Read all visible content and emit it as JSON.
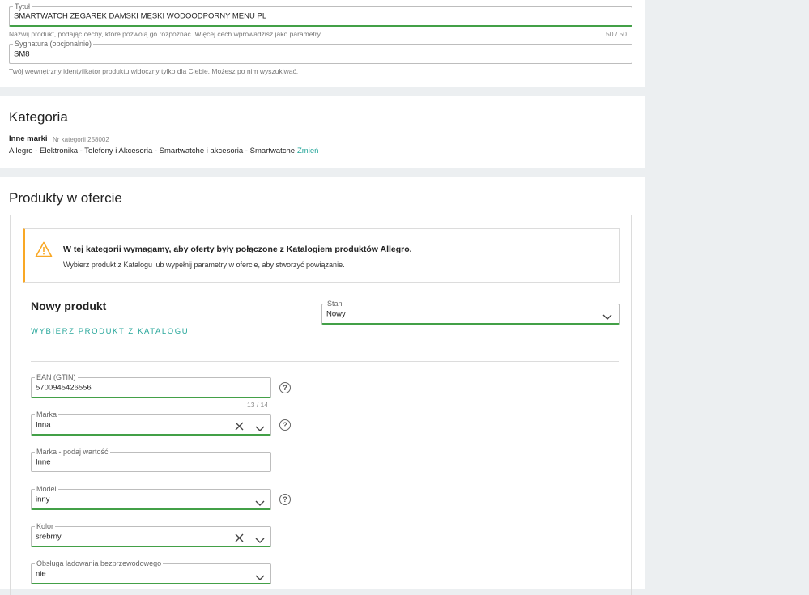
{
  "title_section": {
    "title_field": {
      "legend": "Tytuł",
      "value": "SMARTWATCH ZEGAREK DAMSKI MĘSKI WODOODPORNY MENU PL"
    },
    "title_hint": "Nazwij produkt, podając cechy, które pozwolą go rozpoznać. Więcej cech wprowadzisz jako parametry.",
    "title_counter": "50 / 50",
    "signature_field": {
      "legend": "Sygnatura (opcjonalnie)",
      "value": "SM8"
    },
    "signature_hint": "Twój wewnętrzny identyfikator produktu widoczny tylko dla Ciebie. Możesz po nim wyszukiwać."
  },
  "category": {
    "heading": "Kategoria",
    "name": "Inne marki",
    "number": "Nr kategorii 258002",
    "path": "Allegro - Elektronika - Telefony i Akcesoria - Smartwatche i akcesoria - Smartwatche",
    "change_label": "Zmień"
  },
  "products": {
    "heading": "Produkty w ofercie",
    "alert_title": "W tej kategorii wymagamy, aby oferty były połączone z Katalogiem produktów Allegro.",
    "alert_text": "Wybierz produkt z Katalogu lub wypełnij parametry w ofercie, aby stworzyć powiązanie.",
    "new_product_label": "Nowy produkt",
    "catalog_link": "WYBIERZ PRODUKT Z KATALOGU",
    "state": {
      "legend": "Stan",
      "value": "Nowy"
    },
    "ean": {
      "legend": "EAN (GTIN)",
      "value": "5700945426556",
      "counter": "13 / 14"
    },
    "brand": {
      "legend": "Marka",
      "value": "Inna"
    },
    "brand_value": {
      "legend": "Marka - podaj wartość",
      "value": "Inne"
    },
    "model": {
      "legend": "Model",
      "value": "inny"
    },
    "color": {
      "legend": "Kolor",
      "value": "srebrny"
    },
    "wireless": {
      "legend": "Obsługa ładowania bezprzewodowego",
      "value": "nie"
    }
  },
  "colors": {
    "accent": "#26a69a",
    "active_border": "#43a047",
    "warning": "#f9a825"
  },
  "icons": {
    "warning": "warning-icon",
    "help": "help-icon",
    "chevron": "chevron-down-icon",
    "clear": "clear-icon"
  }
}
